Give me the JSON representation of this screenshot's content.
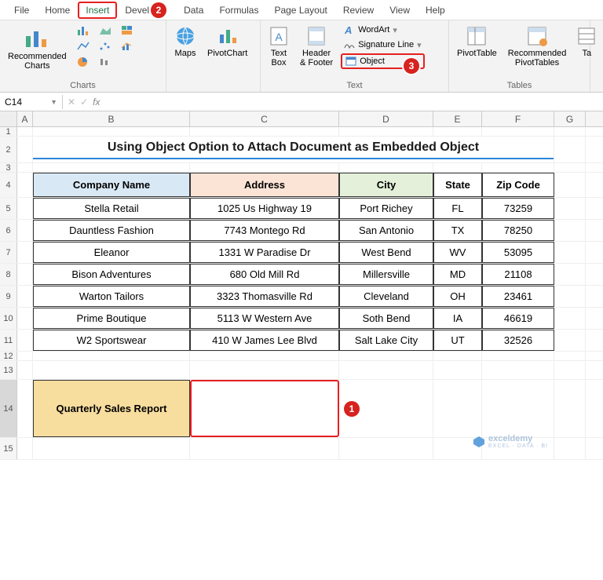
{
  "tabs": [
    "File",
    "Home",
    "Insert",
    "Developer",
    "Data",
    "Formulas",
    "Page Layout",
    "Review",
    "View",
    "Help"
  ],
  "active_tab": "Insert",
  "ribbon": {
    "charts_label": "Charts",
    "recommended_charts": "Recommended\nCharts",
    "maps": "Maps",
    "pivotchart": "PivotChart",
    "text_label": "Text",
    "textbox": "Text\nBox",
    "headerfooter": "Header\n& Footer",
    "wordart": "WordArt",
    "sigline": "Signature Line",
    "object": "Object",
    "tables_label": "Tables",
    "pivottable": "PivotTable",
    "rec_pivots": "Recommended\nPivotTables",
    "table": "Ta"
  },
  "callouts": {
    "c1": "1",
    "c2": "2",
    "c3": "3"
  },
  "namebox": "C14",
  "fx": "fx",
  "cols": [
    "A",
    "B",
    "C",
    "D",
    "E",
    "F",
    "G"
  ],
  "title": "Using Object Option to Attach Document as Embedded Object",
  "headers": {
    "b": "Company Name",
    "c": "Address",
    "d": "City",
    "e": "State",
    "f": "Zip Code"
  },
  "rows": [
    {
      "b": "Stella Retail",
      "c": "1025 Us Highway 19",
      "d": "Port Richey",
      "e": "FL",
      "f": "73259"
    },
    {
      "b": "Dauntless Fashion",
      "c": "7743 Montego Rd",
      "d": "San Antonio",
      "e": "TX",
      "f": "78250"
    },
    {
      "b": "Eleanor",
      "c": "1331 W Paradise Dr",
      "d": "West Bend",
      "e": "WV",
      "f": "53095"
    },
    {
      "b": "Bison Adventures",
      "c": "680 Old Mill Rd",
      "d": "Millersville",
      "e": "MD",
      "f": "21108"
    },
    {
      "b": "Warton Tailors",
      "c": "3323 Thomasville Rd",
      "d": "Cleveland",
      "e": "OH",
      "f": "23461"
    },
    {
      "b": "Prime Boutique",
      "c": "5113 W Western Ave",
      "d": "Soth Bend",
      "e": "IA",
      "f": "46619"
    },
    {
      "b": "W2 Sportswear",
      "c": "410 W James Lee Blvd",
      "d": "Salt Lake City",
      "e": "UT",
      "f": "32526"
    }
  ],
  "report_label": "Quarterly Sales Report",
  "rownums": [
    "1",
    "2",
    "3",
    "4",
    "5",
    "6",
    "7",
    "8",
    "9",
    "10",
    "11",
    "12",
    "13",
    "14",
    "15"
  ],
  "watermark": {
    "brand": "exceldemy",
    "tag": "EXCEL · DATA · BI"
  }
}
